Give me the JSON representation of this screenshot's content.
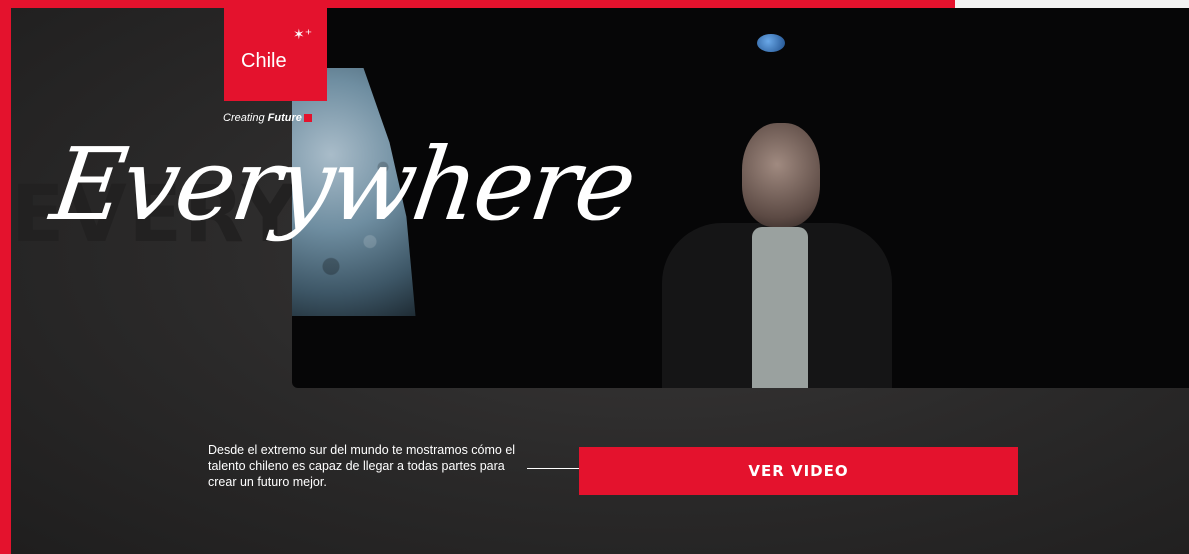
{
  "brand": {
    "logo_text": "Chile",
    "tagline_light": "Creating",
    "tagline_bold": "Future",
    "accent_color": "#e4122d"
  },
  "hero": {
    "background_word": "EVERYWHERE",
    "script_title": "Everywhere"
  },
  "content": {
    "description": "Desde el extremo sur del mundo te mostramos cómo el talento chileno es capaz de llegar a todas partes para crear un futuro mejor.",
    "cta_label": "VER VIDEO"
  },
  "icons": {
    "arrow": "arrow-right-icon",
    "stars": "stars-icon"
  }
}
